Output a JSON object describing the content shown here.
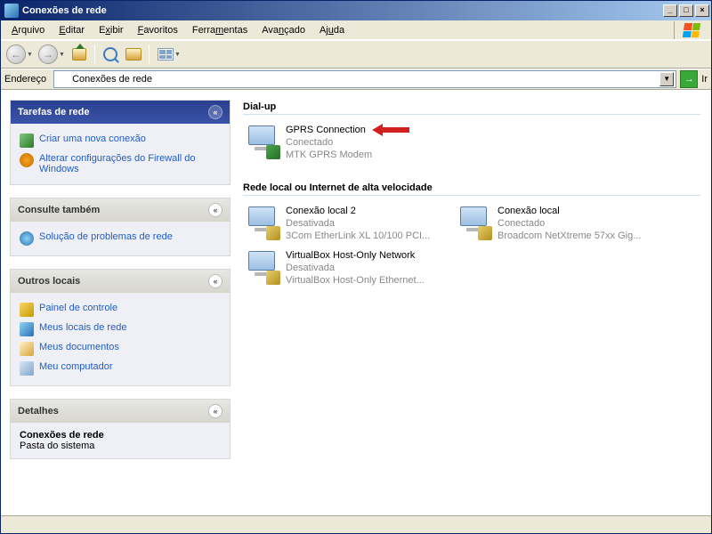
{
  "window": {
    "title": "Conexões de rede"
  },
  "menu": {
    "arquivo": "Arquivo",
    "editar": "Editar",
    "exibir": "Exibir",
    "favoritos": "Favoritos",
    "ferramentas": "Ferramentas",
    "avancado": "Avançado",
    "ajuda": "Ajuda"
  },
  "address": {
    "label": "Endereço",
    "value": "Conexões de rede",
    "go": "Ir"
  },
  "sidebar": {
    "network_tasks": {
      "title": "Tarefas de rede",
      "new_connection": "Criar uma nova conexão",
      "firewall": "Alterar configurações do Firewall do Windows"
    },
    "see_also": {
      "title": "Consulte também",
      "troubleshoot": "Solução de problemas de rede"
    },
    "other_places": {
      "title": "Outros locais",
      "control_panel": "Painel de controle",
      "network_places": "Meus locais de rede",
      "my_documents": "Meus documentos",
      "my_computer": "Meu computador"
    },
    "details": {
      "title": "Detalhes",
      "name": "Conexões de rede",
      "type": "Pasta do sistema"
    }
  },
  "groups": {
    "dialup": "Dial-up",
    "lan": "Rede local ou Internet de alta velocidade"
  },
  "connections": {
    "gprs": {
      "name": "GPRS Connection",
      "status": "Conectado",
      "device": "MTK GPRS Modem"
    },
    "local2": {
      "name": "Conexão local 2",
      "status": "Desativada",
      "device": "3Com EtherLink XL 10/100 PCI..."
    },
    "local": {
      "name": "Conexão local",
      "status": "Conectado",
      "device": "Broadcom NetXtreme 57xx Gig..."
    },
    "vbox": {
      "name": "VirtualBox Host-Only Network",
      "status": "Desativada",
      "device": "VirtualBox Host-Only Ethernet..."
    }
  }
}
